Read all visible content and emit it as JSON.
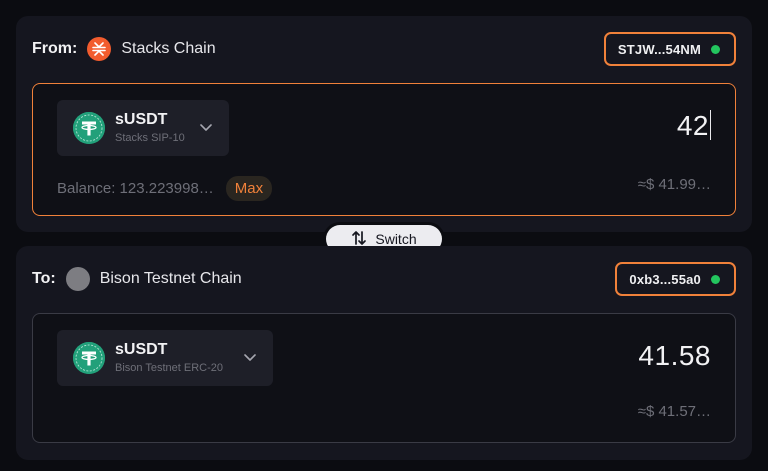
{
  "from": {
    "label": "From:",
    "chain": "Stacks Chain",
    "address": "STJW...54NM",
    "token_symbol": "sUSDT",
    "token_standard": "Stacks SIP-10",
    "amount": "42",
    "balance": "Balance: 123.223998…",
    "max_label": "Max",
    "usd_value": "≈$ 41.99…"
  },
  "switch_label": "Switch",
  "to": {
    "label": "To:",
    "chain": "Bison Testnet Chain",
    "address": "0xb3...55a0",
    "token_symbol": "sUSDT",
    "token_standard": "Bison Testnet ERC-20",
    "amount": "41.58",
    "usd_value": "≈$ 41.57…"
  },
  "colors": {
    "accent": "#f0813a",
    "connected": "#23c55e",
    "tether": "#22a07a",
    "stacks": "#f25c2e"
  },
  "icons": {
    "stacks": "stacks-chain-icon",
    "bison": "bison-chain-icon",
    "token": "tether-icon",
    "chevron": "chevron-down-icon",
    "switch": "swap-arrows-icon"
  }
}
